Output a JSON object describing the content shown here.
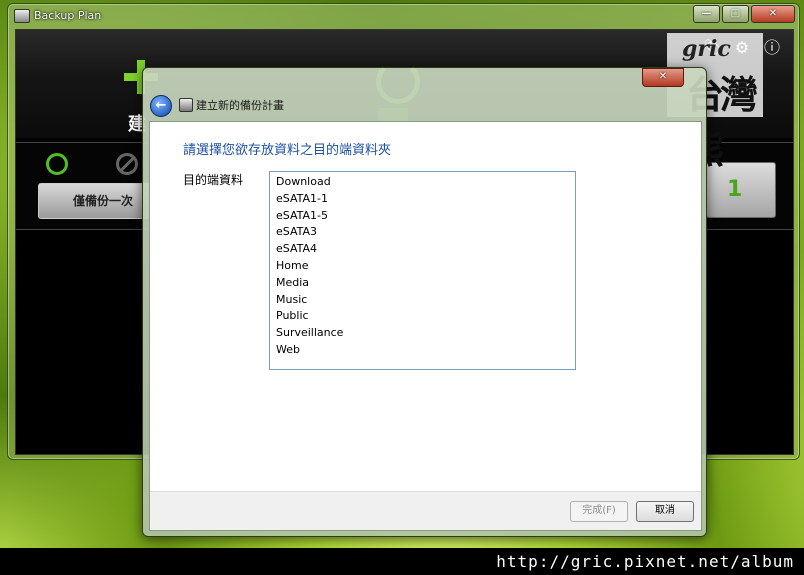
{
  "app": {
    "title": "Backup Plan",
    "window_controls": {
      "minimize": "—",
      "maximize": "□",
      "close": "✕"
    },
    "create_label": "建",
    "backup_once_label": "僅備份一次",
    "plan_number": "1",
    "header_icons": [
      "tag-icon",
      "gear-icon",
      "info-icon"
    ],
    "header_icon_glyphs": [
      "🏷",
      "⚙",
      "ⓘ"
    ]
  },
  "dialog": {
    "title": "建立新的備份計畫",
    "close_glyph": "✕",
    "back_glyph": "←",
    "heading": "請選擇您欲存放資料之目的端資料夾",
    "destination_label": "目的端資料",
    "folders": [
      "Download",
      "eSATA1-1",
      "eSATA1-5",
      "eSATA3",
      "eSATA4",
      "Home",
      "Media",
      "Music",
      "Public",
      "Surveillance",
      "Web"
    ],
    "buttons": {
      "finish": "完成(F)",
      "cancel": "取消"
    }
  },
  "watermark": {
    "line1": "gric",
    "line2": "台灣熊"
  },
  "footer_url": "http://gric.pixnet.net/album"
}
